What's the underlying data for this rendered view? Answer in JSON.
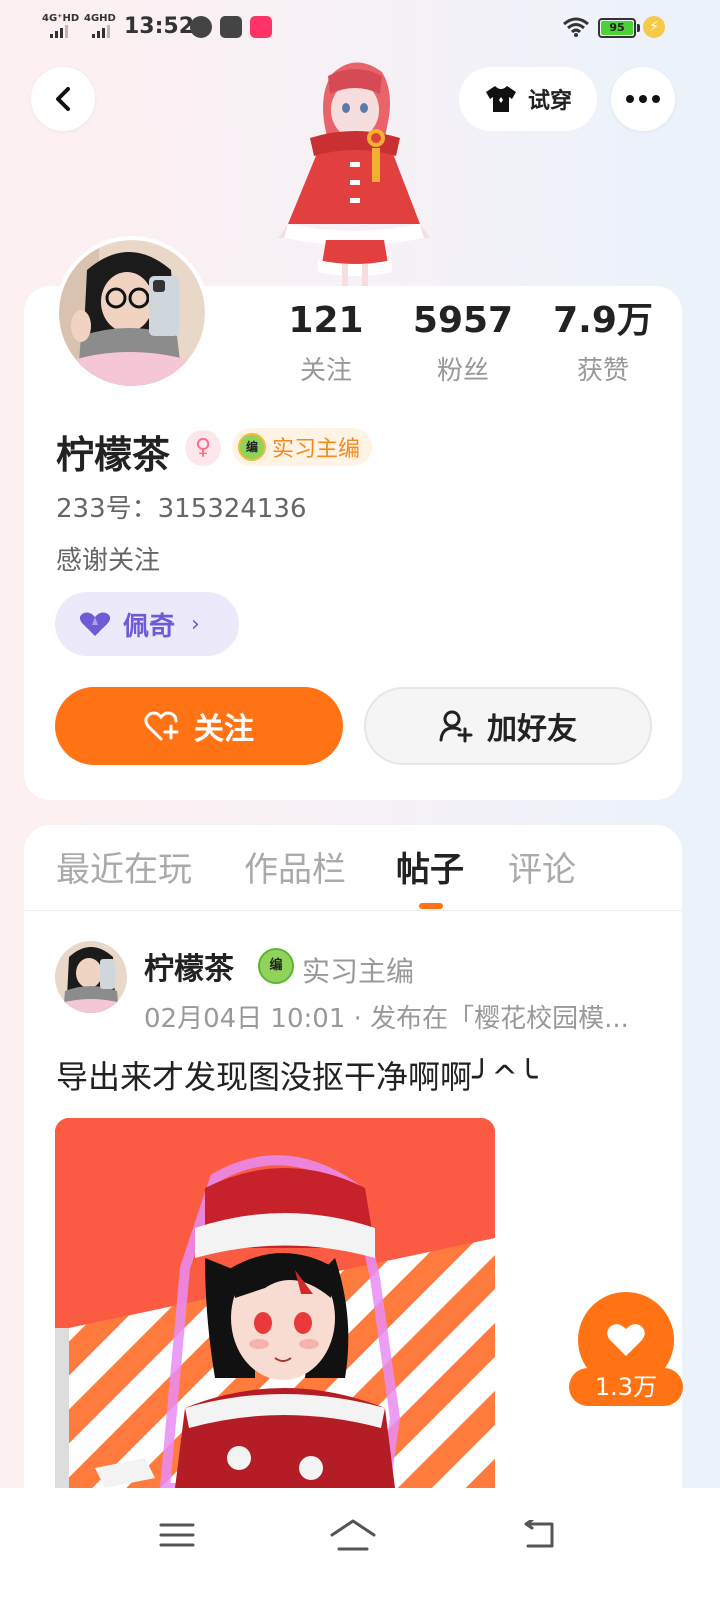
{
  "status_bar": {
    "net1": "4G⁺HD",
    "net2": "4GHD",
    "time": "13:52",
    "battery": "95"
  },
  "header": {
    "back_icon": "chevron-left-icon",
    "tryon_label": "试穿",
    "tryon_icon": "tshirt-icon",
    "more_icon": "more-horizontal-icon"
  },
  "profile": {
    "stats": [
      {
        "value": "121",
        "label": "关注"
      },
      {
        "value": "5957",
        "label": "粉丝"
      },
      {
        "value": "7.9万",
        "label": "获赞"
      }
    ],
    "name": "柠檬茶",
    "gender": "female",
    "rank_icon_text": "编",
    "rank_label": "实习主编",
    "uid": "233号：315324136",
    "bio": "感谢关注",
    "pet_label": "佩奇",
    "follow_label": "关注",
    "add_friend_label": "加好友"
  },
  "tabs": [
    {
      "label": "最近在玩",
      "active": false
    },
    {
      "label": "作品栏",
      "active": false
    },
    {
      "label": "帖子",
      "active": true
    },
    {
      "label": "评论",
      "active": false
    }
  ],
  "post": {
    "author": "柠檬茶",
    "rank_label": "实习主编",
    "meta": "02月04日 10:01 · 发布在「樱花校园模...",
    "text": "导出来才发现图没抠干净啊啊╯^╰"
  },
  "like": {
    "count": "1.3万"
  },
  "colors": {
    "accent": "#ff7314",
    "pet": "#6d5bd7",
    "rank": "#f08a1f"
  }
}
